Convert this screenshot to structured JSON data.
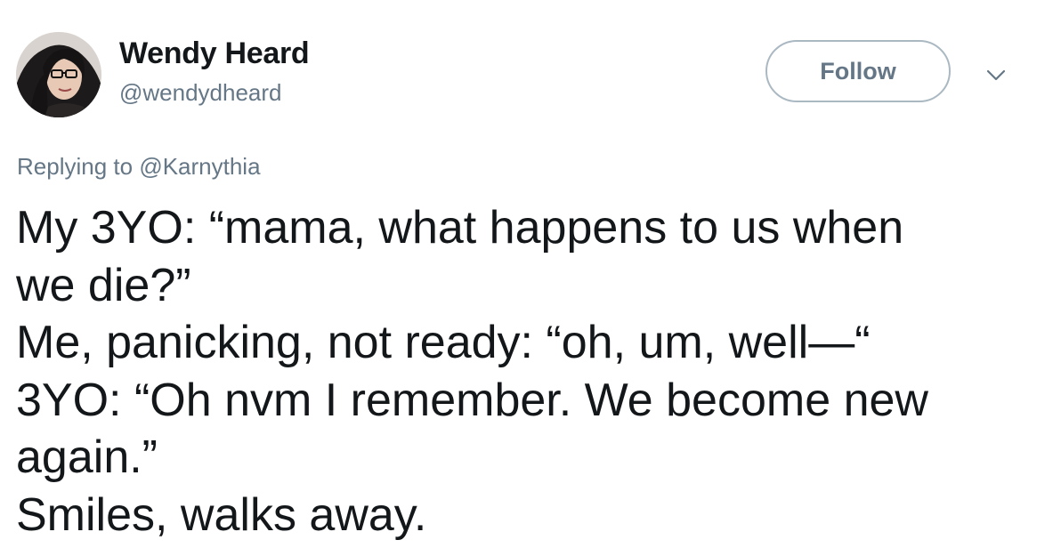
{
  "user": {
    "display_name": "Wendy Heard",
    "handle": "@wendydheard",
    "avatar_icon": "profile-photo"
  },
  "header": {
    "follow_label": "Follow",
    "more_icon": "chevron-down-icon"
  },
  "reply": {
    "prefix": "Replying to",
    "mention": "@Karnythia"
  },
  "tweet": {
    "lines": [
      "My 3YO: “mama, what happens to us when",
      "we die?”",
      "Me, panicking, not ready: “oh, um, well—“",
      "3YO: “Oh nvm I remember. We become new",
      "again.”",
      "Smiles, walks away."
    ]
  },
  "colors": {
    "text": "#14171a",
    "secondary": "#657786",
    "button_border": "#aab8c2"
  }
}
